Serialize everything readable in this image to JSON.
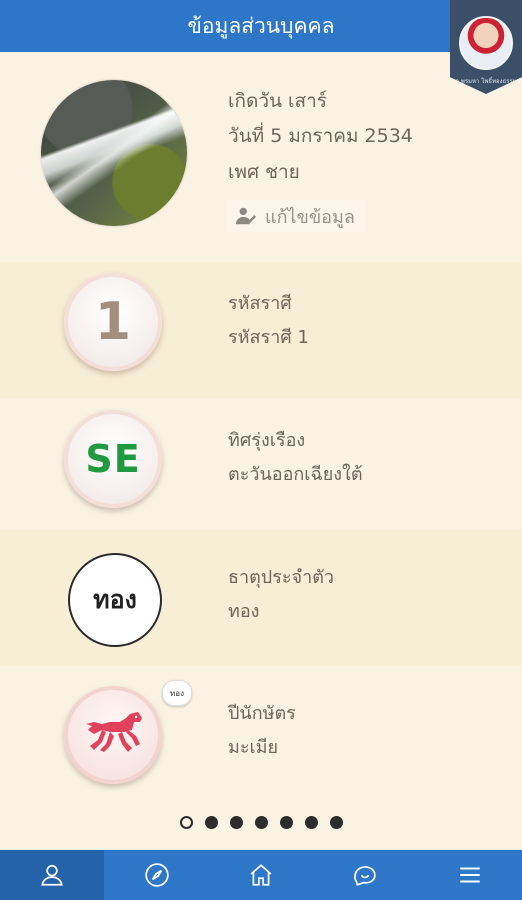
{
  "header": {
    "title": "ข้อมูลส่วนบุคคล"
  },
  "astrologer_badge": {
    "caption": "อ.พรมหา โพธิ์ทองธรรม"
  },
  "profile": {
    "birth_day": "เกิดวัน เสาร์",
    "birth_date": "วันที่ 5 มกราคม 2534",
    "gender": "เพศ ชาย",
    "edit_label": "แก้ไขข้อมูล"
  },
  "sections": {
    "zodiac": {
      "number": "1",
      "label": "รหัสราศี",
      "value": "รหัสราศี 1"
    },
    "direction": {
      "code": "SE",
      "label": "ทิศรุ่งเรือง",
      "value": "ตะวันออกเฉียงใต้"
    },
    "element": {
      "symbol": "ทอง",
      "label": "ธาตุประจำตัว",
      "value": "ทอง"
    },
    "animal_year": {
      "badge": "ทอง",
      "label": "ปีนักษัตร",
      "value": "มะเมีย"
    }
  },
  "pagination": {
    "total": 7,
    "active": 1
  },
  "colors": {
    "primary": "#2d76c8",
    "background": "#faf3e4",
    "direction_accent": "#1f9a3e",
    "horse": "#e0415c"
  },
  "tabs": [
    "person-icon",
    "compass-icon",
    "home-icon",
    "chat-icon",
    "menu-icon"
  ]
}
